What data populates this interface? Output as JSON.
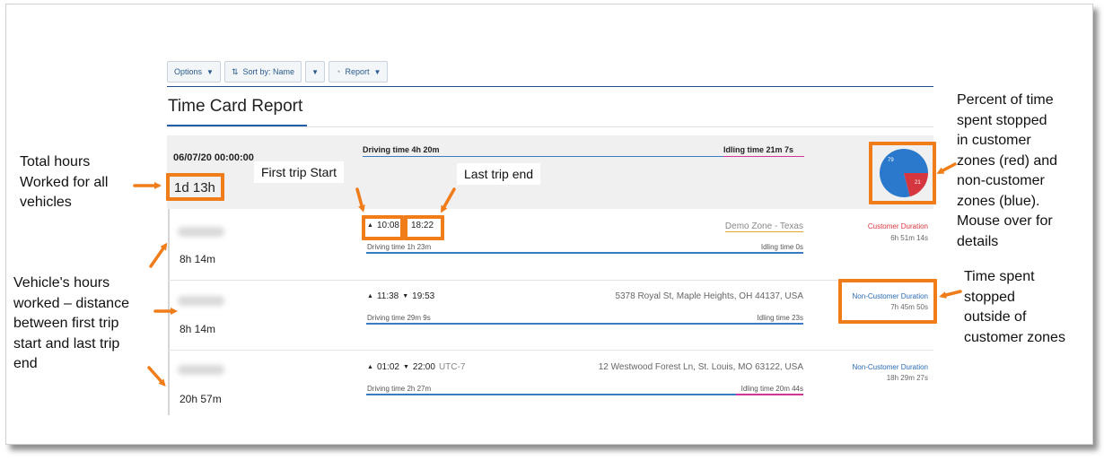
{
  "toolbar": {
    "options_label": "Options",
    "sort_label": "Sort by: Name",
    "report_label": "Report"
  },
  "report": {
    "title": "Time Card Report",
    "summary": {
      "date": "06/07/20 00:00:00",
      "total_hours": "1d 13h",
      "driving_label": "Driving time 4h 20m",
      "idling_label": "Idling time 21m 7s",
      "pie": {
        "blue_label": "79",
        "red_label": "21",
        "blue_percent": 79,
        "red_percent": 21,
        "blue_color": "#2b79cc",
        "red_color": "#d6363f"
      }
    },
    "vehicles": [
      {
        "hours": "8h 14m",
        "start_time": "10:08",
        "end_time": "18:22",
        "utc": "",
        "location": "Demo Zone - Texas",
        "driving": "Driving time 1h 23m",
        "idling": "Idling time 0s",
        "zone_type": "Customer Duration",
        "zone_duration": "6h 51m 14s"
      },
      {
        "hours": "8h 14m",
        "start_time": "11:38",
        "end_time": "19:53",
        "utc": "",
        "location": "5378 Royal St, Maple Heights, OH 44137, USA",
        "driving": "Driving time 29m 9s",
        "idling": "Idling time 23s",
        "zone_type": "Non-Customer Duration",
        "zone_duration": "7h 45m 50s"
      },
      {
        "hours": "20h 57m",
        "start_time": "01:02",
        "end_time": "22:00",
        "utc": "UTC-7",
        "location": "12 Westwood Forest Ln, St. Louis, MO 63122, USA",
        "driving": "Driving time 2h 27m",
        "idling": "Idling time 20m 44s",
        "zone_type": "Non-Customer Duration",
        "zone_duration": "18h 29m 27s"
      }
    ]
  },
  "annotations": {
    "total_hours": [
      "Total hours",
      "Worked for all",
      "vehicles"
    ],
    "vehicle_hours": [
      "Vehicle's hours",
      "worked – distance",
      "between first trip",
      "start and last trip",
      "end"
    ],
    "first_trip": "First trip Start",
    "last_trip": "Last trip end",
    "percent_time": [
      "Percent of time",
      "spent stopped",
      "in customer",
      "zones (red) and",
      "non-customer",
      "zones (blue).",
      "Mouse over for",
      "details"
    ],
    "time_outside": [
      "Time spent",
      "stopped",
      "outside of",
      "customer zones"
    ]
  },
  "colors": {
    "accent_orange": "#f07c1a",
    "link_blue": "#2a6bb5",
    "customer_red": "#d9363e"
  }
}
